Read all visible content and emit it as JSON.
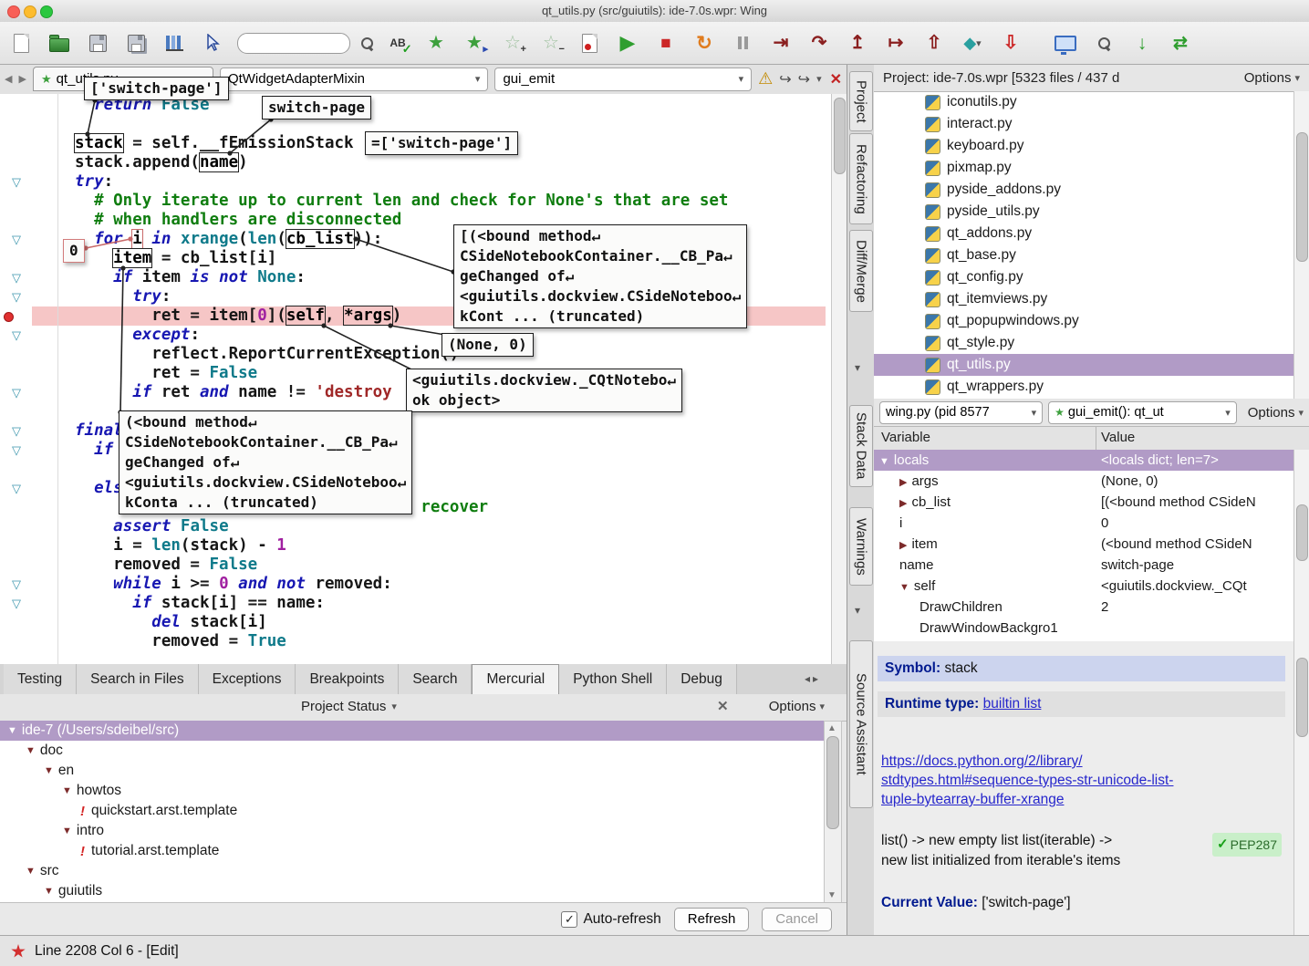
{
  "window": {
    "title": "qt_utils.py (src/guiutils): ide-7.0s.wpr: Wing",
    "status_line": "Line 2208 Col 6 - [Edit]"
  },
  "toolbar": {
    "search_value": ""
  },
  "editor_nav": {
    "file_tab": "qt_utils.py",
    "scope": "QtWidgetAdapterMixin",
    "symbol": "gui_emit"
  },
  "editor": {
    "lines": [
      {
        "seg": [
          [
            "p",
            "  "
          ],
          [
            "k",
            "return"
          ],
          [
            "p",
            " "
          ],
          [
            "b",
            "False"
          ]
        ]
      },
      {
        "seg": []
      },
      {
        "seg": [
          [
            "x",
            "stack"
          ],
          [
            "p",
            " = self.__fEmissionStack"
          ]
        ]
      },
      {
        "seg": [
          [
            "p",
            "stack.append("
          ],
          [
            "x",
            "name"
          ],
          [
            "p",
            ")"
          ]
        ]
      },
      {
        "g": "f",
        "seg": [
          [
            "k",
            "try"
          ],
          [
            "p",
            ":"
          ]
        ]
      },
      {
        "seg": [
          [
            "p",
            "  "
          ],
          [
            "c",
            "# Only iterate up to current len and check for None's that are set"
          ]
        ]
      },
      {
        "seg": [
          [
            "p",
            "  "
          ],
          [
            "c",
            "# when handlers are disconnected"
          ]
        ]
      },
      {
        "g": "f",
        "seg": [
          [
            "p",
            "  "
          ],
          [
            "k",
            "for"
          ],
          [
            "p",
            " "
          ],
          [
            "y",
            "i"
          ],
          [
            "p",
            " "
          ],
          [
            "k",
            "in"
          ],
          [
            "p",
            " "
          ],
          [
            "b",
            "xrange"
          ],
          [
            "p",
            "("
          ],
          [
            "b",
            "len"
          ],
          [
            "p",
            "("
          ],
          [
            "x",
            "cb_list"
          ],
          [
            "p",
            ")):"
          ]
        ]
      },
      {
        "seg": [
          [
            "p",
            "    "
          ],
          [
            "x",
            "item"
          ],
          [
            "p",
            " = cb_list[i]"
          ]
        ]
      },
      {
        "g": "f",
        "seg": [
          [
            "p",
            "    "
          ],
          [
            "k",
            "if"
          ],
          [
            "p",
            " item "
          ],
          [
            "k",
            "is"
          ],
          [
            "p",
            " "
          ],
          [
            "k",
            "not"
          ],
          [
            "p",
            " "
          ],
          [
            "b",
            "None"
          ],
          [
            "p",
            ":"
          ]
        ]
      },
      {
        "g": "f",
        "seg": [
          [
            "p",
            "      "
          ],
          [
            "k",
            "try"
          ],
          [
            "p",
            ":"
          ]
        ]
      },
      {
        "g": "b",
        "pink": true,
        "seg": [
          [
            "p",
            "        ret = item["
          ],
          [
            "n",
            "0"
          ],
          [
            "p",
            "]("
          ],
          [
            "x",
            "self"
          ],
          [
            "p",
            ", "
          ],
          [
            "x",
            "*args"
          ],
          [
            "p",
            ")"
          ]
        ]
      },
      {
        "g": "f",
        "seg": [
          [
            "p",
            "      "
          ],
          [
            "k",
            "except"
          ],
          [
            "p",
            ":"
          ]
        ]
      },
      {
        "seg": [
          [
            "p",
            "        reflect.ReportCurrentException()"
          ]
        ]
      },
      {
        "seg": [
          [
            "p",
            "        ret = "
          ],
          [
            "b",
            "False"
          ]
        ]
      },
      {
        "g": "f",
        "seg": [
          [
            "p",
            "      "
          ],
          [
            "k",
            "if"
          ],
          [
            "p",
            " ret "
          ],
          [
            "k",
            "and"
          ],
          [
            "p",
            " name != "
          ],
          [
            "s",
            "'destroy"
          ]
        ]
      },
      {
        "seg": []
      },
      {
        "g": "f",
        "seg": [
          [
            "k",
            "finally"
          ],
          [
            "p",
            ":"
          ]
        ]
      },
      {
        "g": "f",
        "seg": [
          [
            "p",
            "  "
          ],
          [
            "k",
            "if"
          ]
        ]
      },
      {
        "seg": []
      },
      {
        "g": "f",
        "seg": [
          [
            "p",
            "  "
          ],
          [
            "k",
            "else"
          ],
          [
            "p",
            ":"
          ]
        ]
      },
      {
        "seg": [
          [
            "p",
            "                                    "
          ],
          [
            "c",
            "recover"
          ]
        ]
      },
      {
        "seg": [
          [
            "p",
            "    "
          ],
          [
            "k",
            "assert"
          ],
          [
            "p",
            " "
          ],
          [
            "b",
            "False"
          ]
        ]
      },
      {
        "seg": [
          [
            "p",
            "    i = "
          ],
          [
            "b",
            "len"
          ],
          [
            "p",
            "(stack) - "
          ],
          [
            "n",
            "1"
          ]
        ]
      },
      {
        "seg": [
          [
            "p",
            "    removed = "
          ],
          [
            "b",
            "False"
          ]
        ]
      },
      {
        "g": "f",
        "seg": [
          [
            "p",
            "    "
          ],
          [
            "k",
            "while"
          ],
          [
            "p",
            " i >= "
          ],
          [
            "n",
            "0"
          ],
          [
            "p",
            " "
          ],
          [
            "k",
            "and"
          ],
          [
            "p",
            " "
          ],
          [
            "k",
            "not"
          ],
          [
            "p",
            " removed:"
          ]
        ]
      },
      {
        "g": "f",
        "seg": [
          [
            "p",
            "      "
          ],
          [
            "k",
            "if"
          ],
          [
            "p",
            " stack[i] == name:"
          ]
        ]
      },
      {
        "seg": [
          [
            "p",
            "        "
          ],
          [
            "k",
            "del"
          ],
          [
            "p",
            " stack[i]"
          ]
        ]
      },
      {
        "seg": [
          [
            "p",
            "        removed = "
          ],
          [
            "b",
            "True"
          ]
        ]
      }
    ],
    "tooltips": [
      {
        "id": "stack",
        "lines": [
          "['switch-page']"
        ]
      },
      {
        "id": "name",
        "lines": [
          "switch-page"
        ]
      },
      {
        "id": "inline",
        "lines": [
          "=['switch-page']"
        ]
      },
      {
        "id": "i",
        "lines": [
          "0"
        ],
        "red": true
      },
      {
        "id": "cb_list",
        "lines": [
          "[(<bound method↵",
          "CSideNotebookContainer.__CB_Pa↵",
          "geChanged of↵",
          "<guiutils.dockview.CSideNoteboo↵",
          "kCont ... (truncated)"
        ]
      },
      {
        "id": "args",
        "lines": [
          "(None, 0)"
        ]
      },
      {
        "id": "self",
        "lines": [
          "<guiutils.dockview._CQtNotebo↵",
          "ok object>"
        ]
      },
      {
        "id": "item",
        "lines": [
          "(<bound method↵",
          "CSideNotebookContainer.__CB_Pa↵",
          "geChanged of↵",
          "<guiutils.dockview.CSideNoteboo↵",
          "kConta ... (truncated)"
        ]
      }
    ]
  },
  "right_tabs": [
    "Project",
    "Refactoring",
    "Diff/Merge",
    "Stack Data",
    "Warnings",
    "Source Assistant"
  ],
  "project": {
    "title": "Project: ide-7.0s.wpr [5323 files / 437 d",
    "options_label": "Options",
    "files": [
      "iconutils.py",
      "interact.py",
      "keyboard.py",
      "pixmap.py",
      "pyside_addons.py",
      "pyside_utils.py",
      "qt_addons.py",
      "qt_base.py",
      "qt_config.py",
      "qt_itemviews.py",
      "qt_popupwindows.py",
      "qt_style.py",
      "qt_utils.py",
      "qt_wrappers.py"
    ],
    "selected_index": 12
  },
  "stack": {
    "thread": "wing.py (pid 8577",
    "frame": "gui_emit(): qt_ut",
    "options_label": "Options",
    "columns": [
      "Variable",
      "Value"
    ],
    "rows": [
      {
        "indent": 0,
        "arrow": "down",
        "name": "locals",
        "value": "<locals dict; len=7>",
        "selected": true
      },
      {
        "indent": 1,
        "arrow": "right",
        "name": "args",
        "value": "(None, 0)"
      },
      {
        "indent": 1,
        "arrow": "right",
        "name": "cb_list",
        "value": "[(<bound method CSideN"
      },
      {
        "indent": 1,
        "name": "i",
        "value": "0"
      },
      {
        "indent": 1,
        "arrow": "right",
        "name": "item",
        "value": "(<bound method CSideN"
      },
      {
        "indent": 1,
        "name": "name",
        "value": "switch-page"
      },
      {
        "indent": 1,
        "arrow": "down",
        "name": "self",
        "value": "<guiutils.dockview._CQt"
      },
      {
        "indent": 2,
        "name": "DrawChildren",
        "value": "2"
      },
      {
        "indent": 2,
        "name": "DrawWindowBackgro1",
        "value": ""
      }
    ]
  },
  "assistant": {
    "symbol_label": "Symbol:",
    "symbol_value": "stack",
    "runtime_label": "Runtime type:",
    "runtime_link": "builtin list",
    "doc_link_lines": [
      "https://docs.python.org/2/library/",
      "stdtypes.html#sequence-types-str-unicode-list-",
      "tuple-bytearray-buffer-xrange"
    ],
    "description_lines": [
      "list() -> new empty list list(iterable) ->",
      "new list initialized from iterable's items"
    ],
    "badge_label": "PEP287",
    "current_value_label": "Current Value:",
    "current_value": "['switch-page']"
  },
  "bottom": {
    "tabs": [
      "Testing",
      "Search in Files",
      "Exceptions",
      "Breakpoints",
      "Search",
      "Mercurial",
      "Python Shell",
      "Debug"
    ],
    "active_tab": "Mercurial",
    "panel_title": "Project Status",
    "options_label": "Options",
    "tree": [
      {
        "indent": 0,
        "label": "ide-7 (/Users/sdeibel/src)",
        "arrow": true,
        "root": true
      },
      {
        "indent": 1,
        "label": "doc",
        "arrow": true
      },
      {
        "indent": 2,
        "label": "en",
        "arrow": true
      },
      {
        "indent": 3,
        "label": "howtos",
        "arrow": true
      },
      {
        "indent": 4,
        "label": "quickstart.arst.template",
        "flag": true
      },
      {
        "indent": 3,
        "label": "intro",
        "arrow": true
      },
      {
        "indent": 4,
        "label": "tutorial.arst.template",
        "flag": true
      },
      {
        "indent": 1,
        "label": "src",
        "arrow": true
      },
      {
        "indent": 2,
        "label": "guiutils",
        "arrow": true
      }
    ],
    "auto_refresh_label": "Auto-refresh",
    "refresh_label": "Refresh",
    "cancel_label": "Cancel"
  }
}
